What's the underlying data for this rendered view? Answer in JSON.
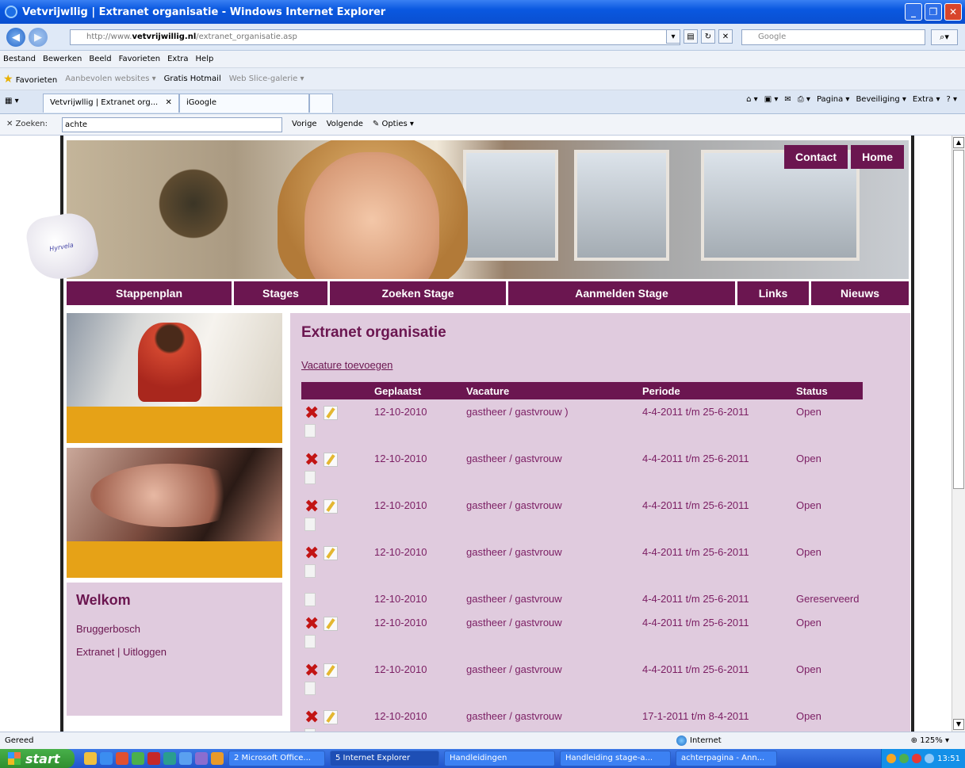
{
  "window": {
    "title": "Vetvrijwllig | Extranet organisatie - Windows Internet Explorer"
  },
  "browser": {
    "url_prefix": "http://www.",
    "url_domain": "vetvrijwillig.nl",
    "url_path": "/extranet_organisatie.asp",
    "search_placeholder": "Google",
    "menu": [
      "Bestand",
      "Bewerken",
      "Beeld",
      "Favorieten",
      "Extra",
      "Help"
    ],
    "favorites": {
      "label": "Favorieten",
      "items": [
        "Aanbevolen websites ▾",
        "Gratis Hotmail",
        "Web Slice-galerie ▾"
      ]
    },
    "tabs": [
      "Vetvrijwllig | Extranet org...",
      "iGoogle"
    ],
    "tools": [
      "Pagina ▾",
      "Beveiliging ▾",
      "Extra ▾"
    ],
    "find": {
      "label": "Zoeken:",
      "value": "achte",
      "prev": "Vorige",
      "next": "Volgende",
      "options": "Opties ▾"
    },
    "status": {
      "text": "Gereed",
      "zone": "Internet",
      "zoom": "125%"
    }
  },
  "site": {
    "top_nav": [
      "Contact",
      "Home"
    ],
    "logo_text": "Hyrvela",
    "main_nav": [
      "Stappenplan",
      "Stages",
      "Zoeken Stage",
      "Aanmelden Stage",
      "Links",
      "Nieuws"
    ],
    "welcome": {
      "title": "Welkom",
      "name": "Bruggerbosch",
      "link_extranet": "Extranet",
      "separator": " | ",
      "link_logout": "Uitloggen"
    },
    "page_title": "Extranet organisatie",
    "add_link": "Vacature toevoegen",
    "table": {
      "headers": [
        "Geplaatst",
        "Vacature",
        "Periode",
        "Status"
      ],
      "rows": [
        {
          "date": "12-10-2010",
          "vacancy": "gastheer / gastvrouw )",
          "period": "4-4-2011 t/m 25-6-2011",
          "status": "Open",
          "editable": true
        },
        {
          "date": "12-10-2010",
          "vacancy": "gastheer / gastvrouw",
          "period": "4-4-2011 t/m 25-6-2011",
          "status": "Open",
          "editable": true
        },
        {
          "date": "12-10-2010",
          "vacancy": "gastheer / gastvrouw",
          "period": "4-4-2011 t/m 25-6-2011",
          "status": "Open",
          "editable": true
        },
        {
          "date": "12-10-2010",
          "vacancy": "gastheer / gastvrouw",
          "period": "4-4-2011 t/m 25-6-2011",
          "status": "Open",
          "editable": true
        },
        {
          "date": "12-10-2010",
          "vacancy": "gastheer / gastvrouw",
          "period": "4-4-2011 t/m 25-6-2011",
          "status": "Gereserveerd",
          "editable": false
        },
        {
          "date": "12-10-2010",
          "vacancy": "gastheer / gastvrouw",
          "period": "4-4-2011 t/m 25-6-2011",
          "status": "Open",
          "editable": true
        },
        {
          "date": "12-10-2010",
          "vacancy": "gastheer / gastvrouw",
          "period": "4-4-2011 t/m 25-6-2011",
          "status": "Open",
          "editable": true
        },
        {
          "date": "12-10-2010",
          "vacancy": "gastheer / gastvrouw",
          "period": "17-1-2011 t/m 8-4-2011",
          "status": "Open",
          "editable": true
        }
      ]
    }
  },
  "taskbar": {
    "start": "start",
    "tasks": [
      "2 Microsoft Office...",
      "5 Internet Explorer",
      "Handleidingen",
      "Handleiding stage-a...",
      "achterpagina - Ann..."
    ],
    "clock": "13:51"
  },
  "colors": {
    "brand": "#6b1650",
    "panel": "#e0cbde",
    "accent": "#e6a217",
    "delete": "#c21414"
  }
}
